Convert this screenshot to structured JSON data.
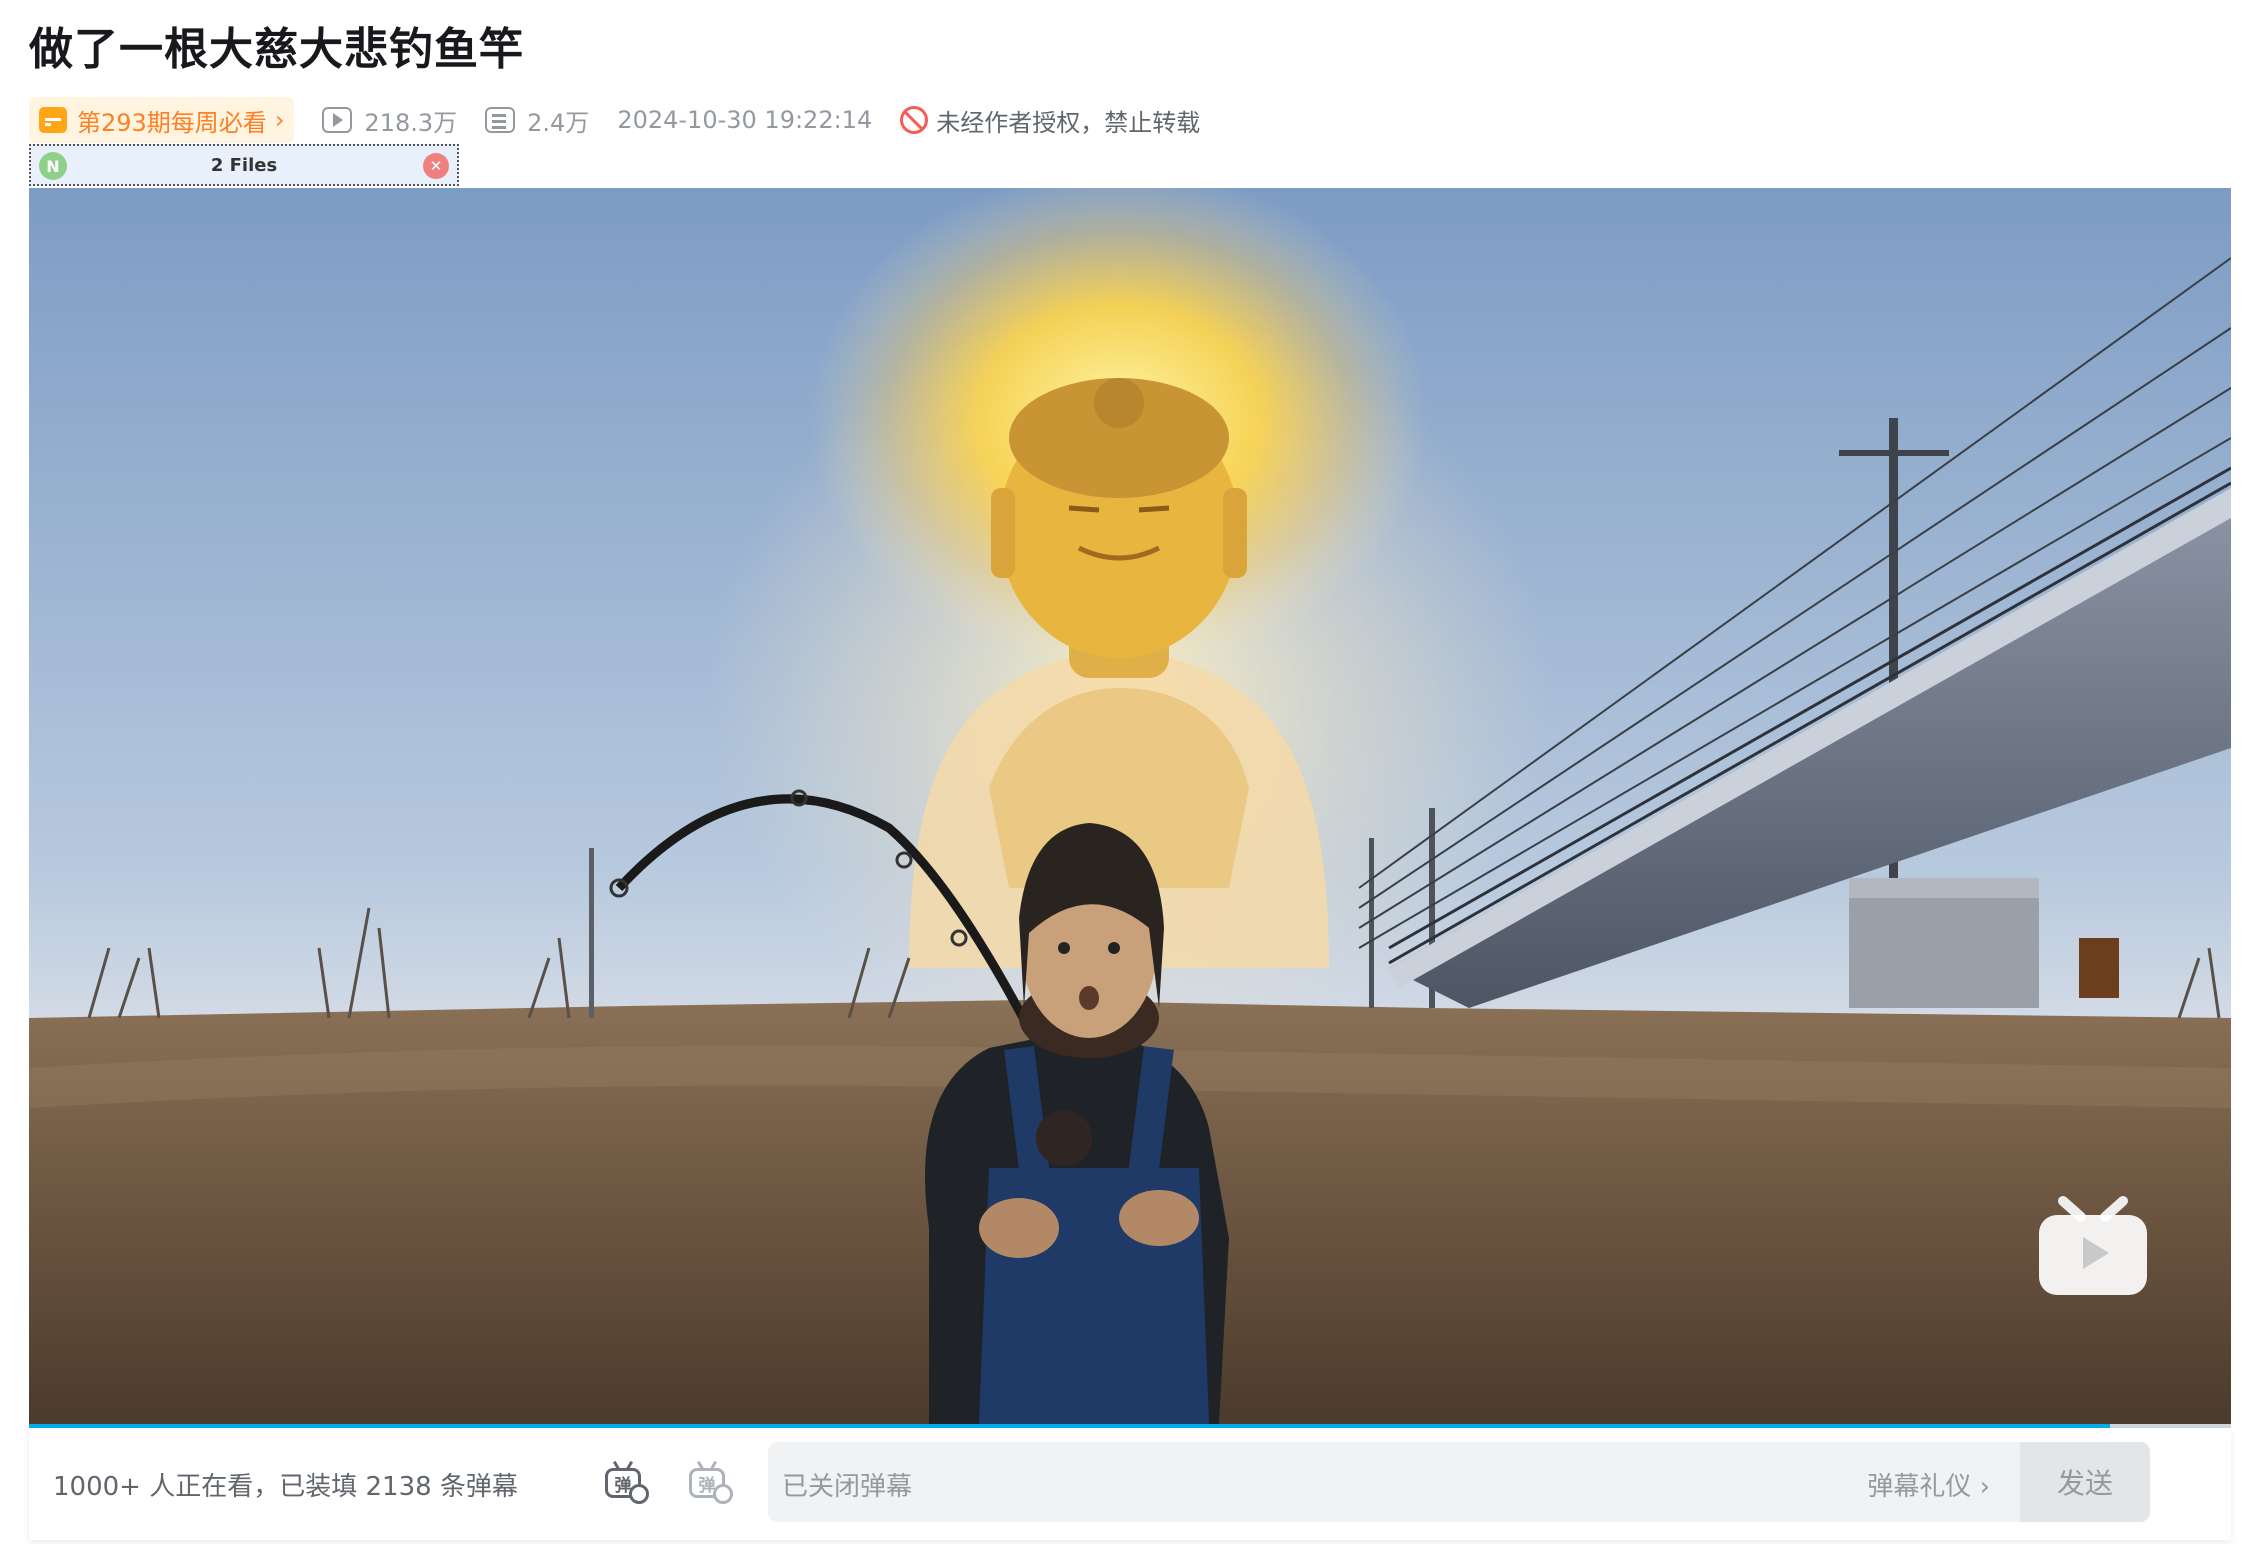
{
  "video": {
    "title": "做了一根大慈大悲钓鱼竿",
    "weekly_label": "第293期每周必看",
    "weekly_chevron": "›",
    "views": "218.3万",
    "danmaku_count": "2.4万",
    "datetime": "2024-10-30 19:22:14",
    "copyright_notice": "未经作者授权，禁止转载"
  },
  "files_widget": {
    "label": "2 Files",
    "icon_letter": "N",
    "close_glyph": "✕"
  },
  "player": {
    "progress_fraction": 0.945,
    "progress_color": "#00aeec"
  },
  "bottom_bar": {
    "viewers_text": "1000+ 人正在看，已装填 2138 条弹幕",
    "danmaku_glyph": "弹",
    "input_placeholder": "已关闭弹幕",
    "etiquette_label": "弹幕礼仪 ›",
    "send_label": "发送"
  },
  "icons": [
    "calendar-icon",
    "play-count-icon",
    "danmaku-count-icon",
    "forbidden-icon",
    "danmaku-toggle-icon",
    "danmaku-settings-icon",
    "bilibili-tv-watermark-icon"
  ]
}
